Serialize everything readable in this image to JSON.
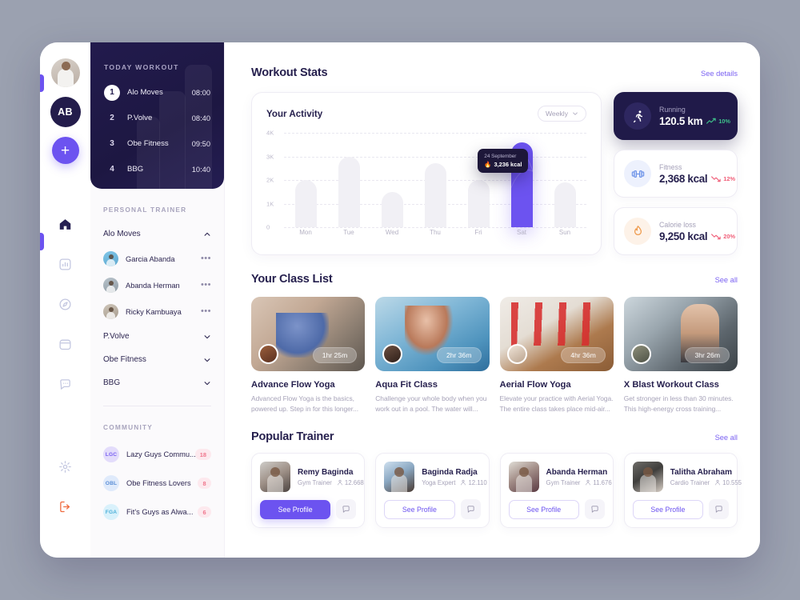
{
  "rail": {
    "avatar_name": "user-photo",
    "badge_label": "AB",
    "add_label": "+",
    "nav": [
      {
        "name": "home-icon",
        "label": "Home"
      },
      {
        "name": "chart-bar-icon",
        "label": "Stats"
      },
      {
        "name": "compass-icon",
        "label": "Explore"
      },
      {
        "name": "calendar-icon",
        "label": "Schedule"
      },
      {
        "name": "chat-icon",
        "label": "Messages"
      }
    ],
    "bottom": [
      {
        "name": "gear-icon",
        "label": "Settings"
      },
      {
        "name": "logout-icon",
        "label": "Logout"
      }
    ]
  },
  "workout_card": {
    "title": "TODAY WORKOUT",
    "items": [
      {
        "num": "1",
        "name": "Alo Moves",
        "time": "08:00"
      },
      {
        "num": "2",
        "name": "P.Volve",
        "time": "08:40"
      },
      {
        "num": "3",
        "name": "Obe Fitness",
        "time": "09:50"
      },
      {
        "num": "4",
        "name": "BBG",
        "time": "10:40"
      }
    ]
  },
  "personal_trainer": {
    "label": "PERSONAL TRAINER",
    "groups": [
      {
        "name": "Alo Moves",
        "expanded": true
      },
      {
        "name": "P.Volve",
        "expanded": false
      },
      {
        "name": "Obe Fitness",
        "expanded": false
      },
      {
        "name": "BBG",
        "expanded": false
      }
    ],
    "trainers": [
      {
        "name": "Garcia Abanda",
        "menu": "•••"
      },
      {
        "name": "Abanda Herman",
        "menu": "•••"
      },
      {
        "name": "Ricky Kambuaya",
        "menu": "•••"
      }
    ]
  },
  "community": {
    "label": "COMMUNITY",
    "items": [
      {
        "initials": "LGC",
        "name": "Lazy Guys Commu...",
        "count": "18",
        "badge_bg": "#e3dcfb",
        "badge_fg": "#7a61f2"
      },
      {
        "initials": "OBL",
        "name": "Obe Fitness Lovers",
        "count": "8",
        "badge_bg": "#dfeafb",
        "badge_fg": "#5b8ed6"
      },
      {
        "initials": "FGA",
        "name": "Fit's Guys as Alwa...",
        "count": "6",
        "badge_bg": "#d9f1fb",
        "badge_fg": "#4fb0d8"
      }
    ]
  },
  "workout_stats": {
    "title": "Workout Stats",
    "see_details": "See details"
  },
  "chart_data": {
    "type": "bar",
    "title": "Your Activity",
    "range_selector": "Weekly",
    "categories": [
      "Mon",
      "Tue",
      "Wed",
      "Thu",
      "Fri",
      "Sat",
      "Sun"
    ],
    "values": [
      2000,
      3000,
      1500,
      2700,
      2000,
      3600,
      1900
    ],
    "highlight_index": 5,
    "ylim": [
      0,
      4000
    ],
    "ytick_labels": [
      "0",
      "1K",
      "2K",
      "3K",
      "4K"
    ],
    "ytick_values": [
      0,
      1000,
      2000,
      3000,
      4000
    ],
    "xlabel": "",
    "ylabel": "",
    "grid": true,
    "legend": "none",
    "tooltip": {
      "date": "24 September",
      "value": "3,236 kcal",
      "icon": "flame-icon"
    },
    "bar_color": "#f1f0f5",
    "highlight_color": "#6c53f0"
  },
  "stat_cards": [
    {
      "label": "Running",
      "value": "120.5 km",
      "pct": "10%",
      "trend": "up",
      "icon": "running-icon",
      "theme": "dark"
    },
    {
      "label": "Fitness",
      "value": "2,368 kcal",
      "pct": "12%",
      "trend": "down",
      "icon": "dumbbell-icon",
      "theme": "light"
    },
    {
      "label": "Calorie loss",
      "value": "9,250 kcal",
      "pct": "20%",
      "trend": "down",
      "icon": "flame-icon",
      "theme": "light"
    }
  ],
  "class_list": {
    "title": "Your Class List",
    "see_all": "See all",
    "classes": [
      {
        "name": "Advance Flow Yoga",
        "duration": "1hr 25m",
        "desc": "Advanced Flow Yoga is the basics, powered up. Step in for this longer..."
      },
      {
        "name": "Aqua Fit Class",
        "duration": "2hr 36m",
        "desc": "Challenge your whole body when you work out in a pool. The water will..."
      },
      {
        "name": "Aerial Flow Yoga",
        "duration": "4hr 36m",
        "desc": "Elevate your practice with Aerial Yoga. The entire class takes place mid-air..."
      },
      {
        "name": "X Blast Workout Class",
        "duration": "3hr 26m",
        "desc": "Get stronger in less than 30 minutes. This high-energy cross training..."
      }
    ]
  },
  "popular_trainer": {
    "title": "Popular Trainer",
    "see_all": "See all",
    "button_label": "See Profile",
    "trainers": [
      {
        "name": "Remy Baginda",
        "role": "Gym Trainer",
        "count": "12.668",
        "primary": true
      },
      {
        "name": "Baginda Radja",
        "role": "Yoga Expert",
        "count": "12.110",
        "primary": false
      },
      {
        "name": "Abanda Herman",
        "role": "Gym Trainer",
        "count": "11.676",
        "primary": false
      },
      {
        "name": "Talitha Abraham",
        "role": "Cardio Trainer",
        "count": "10.555",
        "primary": false
      }
    ]
  },
  "colors": {
    "accent": "#6c53f0",
    "dark": "#201a49",
    "muted": "#a6a2b8",
    "up": "#3ec08a",
    "down": "#f0607a"
  }
}
